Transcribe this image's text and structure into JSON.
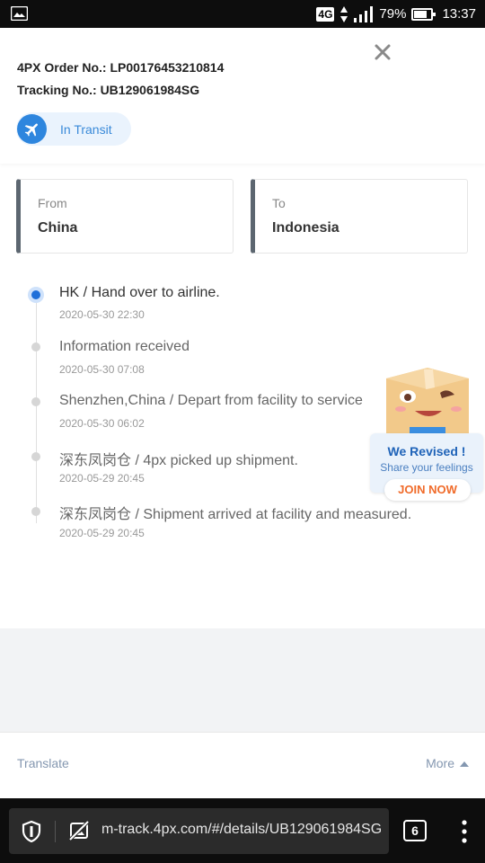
{
  "status_bar": {
    "network": "4G",
    "battery": "79%",
    "battery_level": 0.79,
    "time": "13:37"
  },
  "header": {
    "order_line": "4PX Order No.: LP00176453210814",
    "tracking_line": "Tracking No.: UB129061984SG",
    "status": "In Transit",
    "status_color": "#2e86de"
  },
  "route": {
    "from_label": "From",
    "from_value": "China",
    "to_label": "To",
    "to_value": "Indonesia"
  },
  "timeline": [
    {
      "text": "HK / Hand over to airline.",
      "time": "2020-05-30 22:30"
    },
    {
      "text": "Information received",
      "time": "2020-05-30 07:08"
    },
    {
      "text": "Shenzhen,China / Depart from facility to service",
      "time": "2020-05-30 06:02"
    },
    {
      "text": "深东凤岗仓 / 4px picked up shipment.",
      "time": "2020-05-29 20:45"
    },
    {
      "text": "深东凤岗仓 / Shipment arrived at facility and measured.",
      "time": "2020-05-29 20:45"
    }
  ],
  "promo": {
    "title": "We Revised !",
    "subtitle": "Share your feelings",
    "cta": "JOIN NOW"
  },
  "footer": {
    "translate": "Translate",
    "more": "More"
  },
  "browser": {
    "url": "m-track.4px.com/#/details/UB129061984SG",
    "tab_count": "6"
  },
  "icons": {
    "close": "close-icon",
    "plane": "airplane-icon",
    "shield": "shield-icon",
    "no_image": "image-off-icon",
    "menu": "more-vertical-icon"
  }
}
